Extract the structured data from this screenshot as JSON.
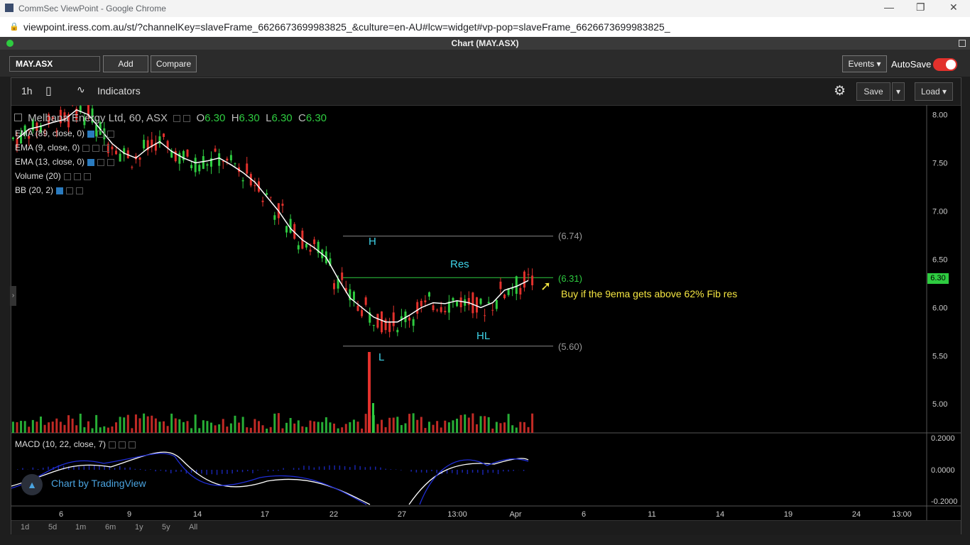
{
  "browser": {
    "window_title": "CommSec ViewPoint - Google Chrome",
    "url": "viewpoint.iress.com.au/st/?channelKey=slaveFrame_6626673699983825_&culture=en-AU#lcw=widget#vp-pop=slaveFrame_6626673699983825_",
    "min_icon": "minimize-icon",
    "max_icon": "restore-icon",
    "close_icon": "close-icon"
  },
  "app": {
    "header_title": "Chart (MAY.ASX)",
    "symbol_value": "MAY.ASX",
    "add_label": "Add",
    "compare_label": "Compare",
    "events_label": "Events",
    "autosave_label": "AutoSave",
    "autosave_on": true
  },
  "chart_toolbar": {
    "interval": "1h",
    "indicators_label": "Indicators",
    "save_label": "Save",
    "load_label": "Load"
  },
  "legend": {
    "title": "Melbana Energy Ltd, 60, ASX",
    "open_label": "O",
    "open": "6.30",
    "high_label": "H",
    "high": "6.30",
    "low_label": "L",
    "low": "6.30",
    "close_label": "C",
    "close": "6.30",
    "studies": [
      "EMA (89, close, 0)",
      "EMA (9, close, 0)",
      "EMA (13, close, 0)",
      "Volume (20)",
      "BB (20, 2)"
    ],
    "macd": "MACD (10, 22, close, 7)"
  },
  "annotations": {
    "H": "H",
    "L": "L",
    "Res": "Res",
    "HL": "HL",
    "fib_high": "(6.74)",
    "fib_mid": "(6.31)",
    "fib_low": "(5.60)",
    "note": "Buy if the 9ema gets above 62% Fib res",
    "note_color": "#f5e642",
    "label_color": "#3fd3e8"
  },
  "branding": "Chart by TradingView",
  "colors": {
    "up": "#2ecc40",
    "down": "#e2312c",
    "ema": "#ffffff",
    "macd_signal": "#1f2dd6"
  },
  "price_tag": "6.30",
  "chart_data": {
    "type": "line",
    "title": "Melbana Energy Ltd, 60, ASX",
    "y_axis_labels": [
      "8.00",
      "7.50",
      "7.00",
      "6.50",
      "6.00",
      "5.50",
      "5.00"
    ],
    "macd_axis_labels": [
      "0.2000",
      "0.0000",
      "-0.2000"
    ],
    "x_axis_labels": [
      "6",
      "9",
      "14",
      "17",
      "22",
      "27",
      "13:00",
      "Apr",
      "6",
      "11",
      "14",
      "19",
      "24",
      "13:00"
    ],
    "ylim": [
      4.7,
      8.1
    ],
    "series": [
      {
        "name": "EMA (9, close, 0)",
        "values": [
          7.75,
          7.85,
          7.88,
          7.92,
          7.95,
          8.05,
          8.0,
          7.85,
          7.7,
          7.6,
          7.55,
          7.65,
          7.72,
          7.62,
          7.55,
          7.5,
          7.52,
          7.55,
          7.48,
          7.4,
          7.3,
          7.15,
          7.0,
          6.82,
          6.7,
          6.62,
          6.52,
          6.3,
          6.1,
          6.0,
          5.9,
          5.85,
          5.85,
          5.92,
          6.0,
          6.05,
          6.04,
          6.07,
          6.05,
          6.0,
          6.05,
          6.18,
          6.22,
          6.28
        ]
      }
    ],
    "fib_levels": [
      6.74,
      6.31,
      5.6
    ]
  },
  "range_buttons": [
    "1d",
    "5d",
    "1m",
    "6m",
    "1y",
    "5y",
    "All"
  ]
}
